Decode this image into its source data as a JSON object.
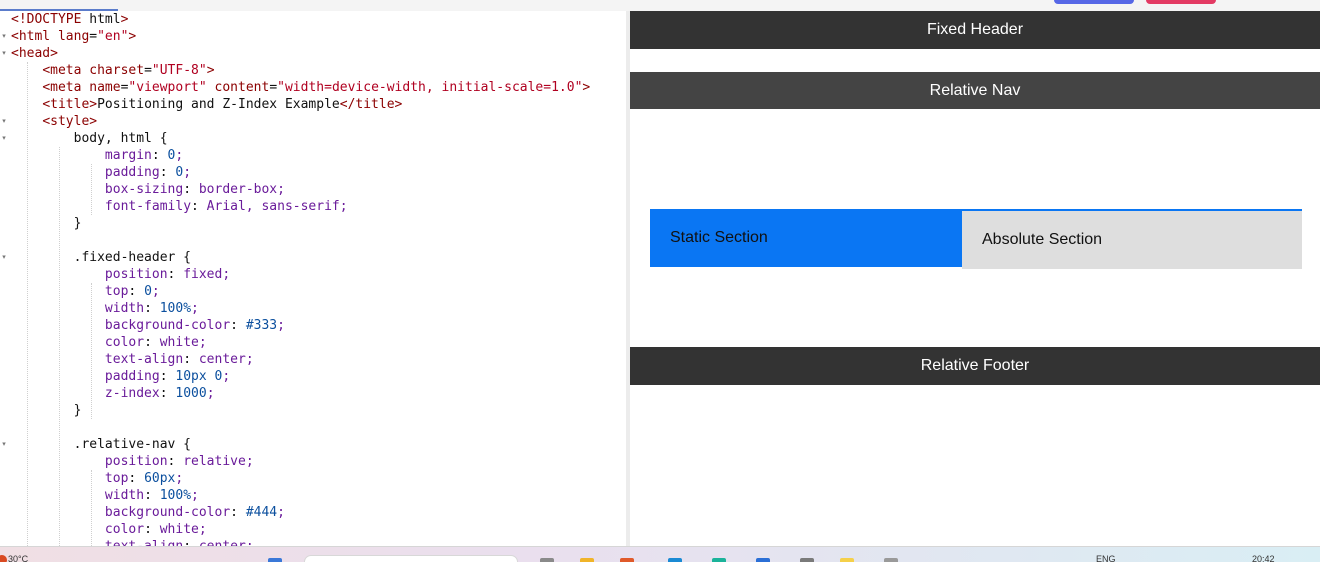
{
  "editor": {
    "lines": [
      "<!DOCTYPE html>",
      "<html lang=\"en\">",
      "<head>",
      "    <meta charset=\"UTF-8\">",
      "    <meta name=\"viewport\" content=\"width=device-width, initial-scale=1.0\">",
      "    <title>Positioning and Z-Index Example</title>",
      "    <style>",
      "        body, html {",
      "            margin: 0;",
      "            padding: 0;",
      "            box-sizing: border-box;",
      "            font-family: Arial, sans-serif;",
      "        }",
      "",
      "        .fixed-header {",
      "            position: fixed;",
      "            top: 0;",
      "            width: 100%;",
      "            background-color: #333;",
      "            color: white;",
      "            text-align: center;",
      "            padding: 10px 0;",
      "            z-index: 1000;",
      "        }",
      "",
      "        .relative-nav {",
      "            position: relative;",
      "            top: 60px;",
      "            width: 100%;",
      "            background-color: #444;",
      "            color: white;",
      "            text-align: center;"
    ],
    "fold_markers": [
      "",
      "▾",
      "▾",
      "",
      "",
      "",
      "▾",
      "▾",
      "",
      "",
      "",
      "",
      "",
      "",
      "▾",
      "",
      "",
      "",
      "",
      "",
      "",
      "",
      "",
      "",
      "",
      "▾",
      "",
      "",
      "",
      "",
      "",
      ""
    ]
  },
  "preview": {
    "fixed_header": "Fixed Header",
    "relative_nav": "Relative Nav",
    "static_section": "Static Section",
    "absolute_section": "Absolute Section",
    "relative_footer": "Relative Footer"
  },
  "taskbar": {
    "weather": "30°C",
    "language": "ENG",
    "time": "20:42"
  },
  "colors": {
    "header_bg": "#333333",
    "nav_bg": "#444444",
    "static_bg": "#0a76f3",
    "absolute_bg": "#dedede",
    "tag_color": "#8b0000",
    "property_color": "#6a1b9a",
    "string_color": "#b00020"
  }
}
